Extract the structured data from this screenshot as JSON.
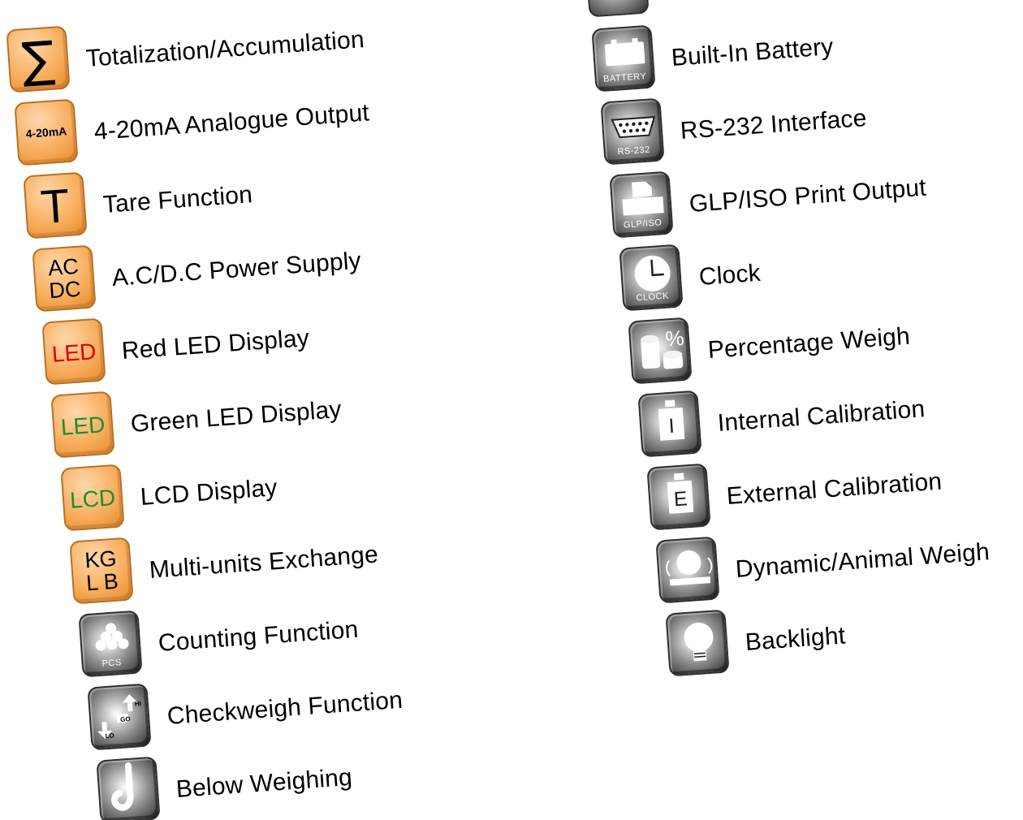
{
  "features_left": [
    {
      "label": "Totalization/Accumulation",
      "icon": "sigma-icon",
      "badge": "orange",
      "symbol": "∑"
    },
    {
      "label": "4-20mA Analogue Output",
      "icon": "analogue-output-icon",
      "badge": "orange",
      "symbol": "4-20mA"
    },
    {
      "label": "Tare Function",
      "icon": "tare-icon",
      "badge": "orange",
      "symbol": "T"
    },
    {
      "label": "A.C/D.C Power Supply",
      "icon": "power-supply-icon",
      "badge": "orange",
      "symbol_top": "AC",
      "symbol_bottom": "DC"
    },
    {
      "label": "Red LED Display",
      "icon": "red-led-icon",
      "badge": "orange",
      "symbol": "LED",
      "symbol_color": "#d90000"
    },
    {
      "label": "Green LED Display",
      "icon": "green-led-icon",
      "badge": "orange",
      "symbol": "LED",
      "symbol_color": "#1a8f32"
    },
    {
      "label": "LCD Display",
      "icon": "lcd-icon",
      "badge": "orange",
      "symbol": "LCD",
      "symbol_color": "#1a8f32"
    },
    {
      "label": "Multi-units Exchange",
      "icon": "multi-units-icon",
      "badge": "orange",
      "symbol_top": "KG",
      "symbol_bottom": "L B"
    },
    {
      "label": "Counting Function",
      "icon": "counting-icon",
      "badge": "gray",
      "caption": "PCS"
    },
    {
      "label": "Checkweigh Function",
      "icon": "checkweigh-icon",
      "badge": "gray",
      "hi": "HI",
      "go": "GO",
      "lo": "LO"
    },
    {
      "label": "Below Weighing",
      "icon": "hook-icon",
      "badge": "gray"
    }
  ],
  "features_right": [
    {
      "label": "Built-In Battery",
      "icon": "battery-icon",
      "badge": "gray",
      "caption": "BATTERY"
    },
    {
      "label": "RS-232 Interface",
      "icon": "rs232-icon",
      "badge": "gray",
      "caption": "RS-232"
    },
    {
      "label": "GLP/ISO Print Output",
      "icon": "print-output-icon",
      "badge": "gray",
      "caption": "GLP/ISO"
    },
    {
      "label": "Clock",
      "icon": "clock-icon",
      "badge": "gray",
      "caption": "CLOCK"
    },
    {
      "label": "Percentage Weigh",
      "icon": "percentage-icon",
      "badge": "gray",
      "symbol": "%"
    },
    {
      "label": "Internal Calibration",
      "icon": "internal-calibration-icon",
      "badge": "gray",
      "symbol": "I"
    },
    {
      "label": "External Calibration",
      "icon": "external-calibration-icon",
      "badge": "gray",
      "symbol": "E"
    },
    {
      "label": "Dynamic/Animal Weigh",
      "icon": "animal-weigh-icon",
      "badge": "gray"
    },
    {
      "label": "Backlight",
      "icon": "bulb-icon",
      "badge": "gray"
    }
  ],
  "colors": {
    "orange": "#f7aa57",
    "orange_dark": "#b86f1f",
    "gray_dark": "#2e2e2e",
    "red_symbol": "#d90000",
    "green_symbol": "#1a8f32"
  }
}
